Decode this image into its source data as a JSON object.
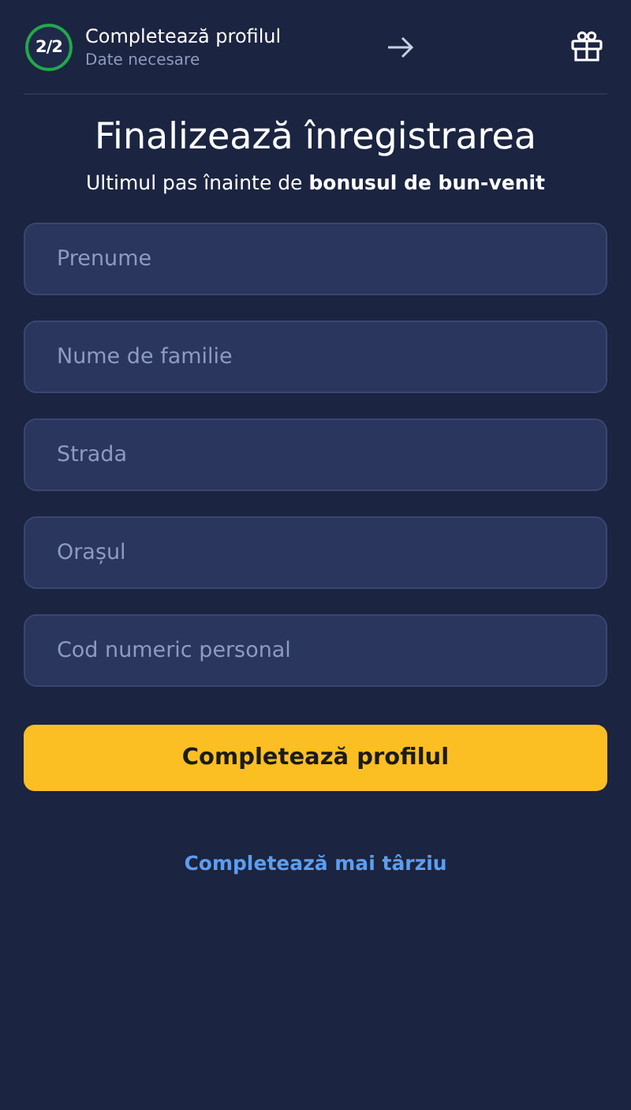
{
  "header": {
    "progress": {
      "text": "2/2"
    },
    "title": "Completează profilul",
    "subtitle": "Date necesare"
  },
  "title": "Finalizează înregistrarea",
  "subtitle": "Ultimul pas înainte de **bonusul de bun-venit**",
  "fields": [
    {
      "placeholder": "Prenume"
    },
    {
      "placeholder": "Nume de familie"
    },
    {
      "placeholder": "Strada"
    },
    {
      "placeholder": "Orașul"
    },
    {
      "placeholder": "Cod numeric personal"
    }
  ],
  "primary_button": "Completează profilul",
  "secondary_link": "Completează mai târziu"
}
